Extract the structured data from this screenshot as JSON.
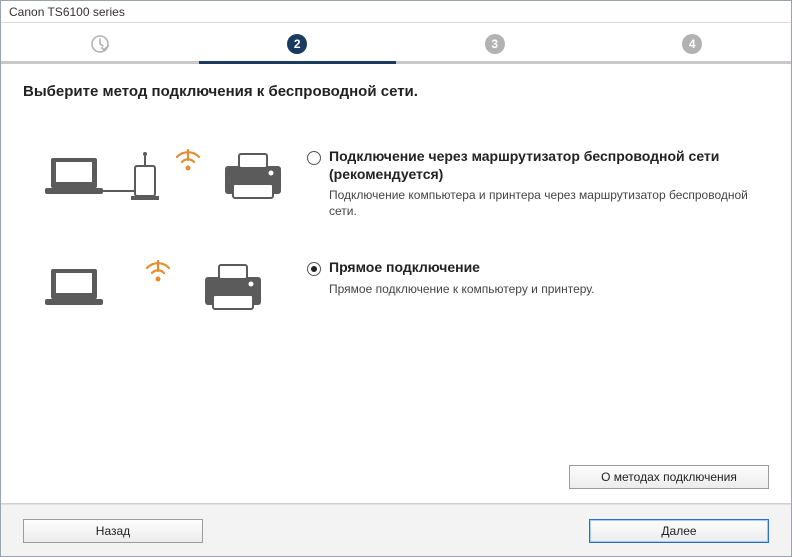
{
  "window": {
    "title": "Canon TS6100 series"
  },
  "steps": {
    "s1": "✓",
    "s2": "2",
    "s3": "3",
    "s4": "4"
  },
  "heading": "Выберите метод подключения к беспроводной сети.",
  "options": {
    "router": {
      "label": "Подключение через маршрутизатор беспроводной сети (рекомендуется)",
      "desc": "Подключение компьютера и принтера через маршрутизатор беспроводной сети.",
      "checked": false
    },
    "direct": {
      "label": "Прямое подключение",
      "desc": "Прямое подключение к компьютеру и принтеру.",
      "checked": true
    }
  },
  "buttons": {
    "about": "О методах подключения",
    "back": "Назад",
    "next": "Далее"
  }
}
